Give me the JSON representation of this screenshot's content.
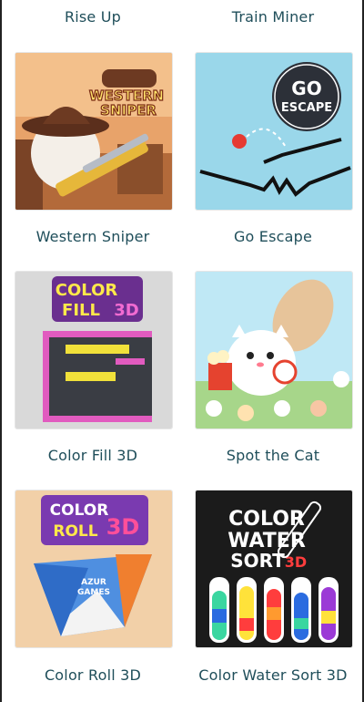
{
  "games": {
    "top": [
      {
        "title": "Rise Up"
      },
      {
        "title": "Train Miner"
      }
    ],
    "items": [
      {
        "title": "Western Sniper",
        "art_text": [
          "WESTERN",
          "SNIPER"
        ]
      },
      {
        "title": "Go Escape",
        "art_text": [
          "GO",
          "ESCAPE"
        ]
      },
      {
        "title": "Color Fill 3D",
        "art_text": [
          "COLOR",
          "FILL",
          "3D"
        ]
      },
      {
        "title": "Spot the Cat",
        "art_text": []
      },
      {
        "title": "Color Roll 3D",
        "art_text": [
          "COLOR",
          "ROLL",
          "3D",
          "AZUR",
          "GAMES"
        ]
      },
      {
        "title": "Color Water Sort 3D",
        "art_text": [
          "COLOR",
          "WATER",
          "SORT",
          "3D"
        ]
      }
    ]
  },
  "colors": {
    "label_text": "#1f4e5a",
    "go_escape_bg": "#9ad7ea",
    "cat_bg": "#bfe8f5",
    "water_sort_bg": "#1b1b1b"
  }
}
